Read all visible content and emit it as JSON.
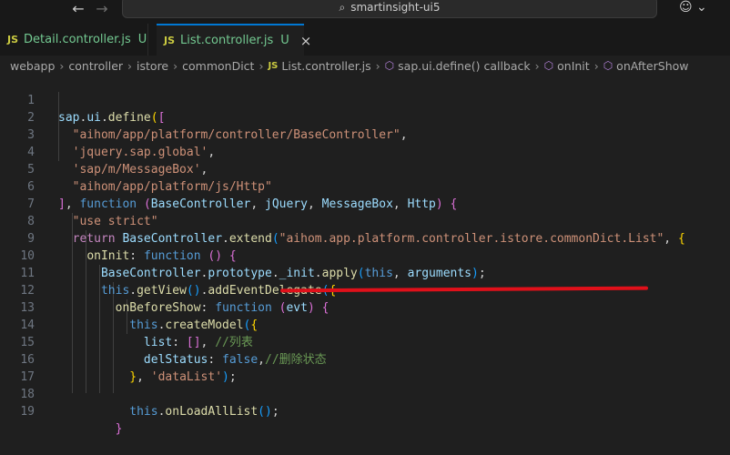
{
  "titlebar": {
    "search_text": "smartinsight-ui5",
    "back_icon": "arrow-left-icon",
    "forward_icon": "arrow-right-icon",
    "search_icon": "search-icon",
    "copilot_icon": "copilot-icon"
  },
  "tabs": [
    {
      "badge": "JS",
      "label": "Detail.controller.js",
      "status": "U",
      "active": false
    },
    {
      "badge": "JS",
      "label": "List.controller.js",
      "status": "U",
      "active": true,
      "close": "×"
    }
  ],
  "breadcrumb": {
    "items": [
      "webapp",
      "controller",
      "istore",
      "commonDict"
    ],
    "file_badge": "JS",
    "file": "List.controller.js",
    "symbols": [
      "sap.ui.define() callback",
      "onInit",
      "onAfterShow"
    ]
  },
  "editor": {
    "line_numbers": [
      "1",
      "2",
      "3",
      "4",
      "5",
      "6",
      "7",
      "8",
      "9",
      "10",
      "11",
      "12",
      "13",
      "14",
      "15",
      "16",
      "17",
      "18",
      "19"
    ],
    "lines": [
      "sap.ui.define([",
      "  \"aihom/app/platform/controller/BaseController\",",
      "  'jquery.sap.global',",
      "  'sap/m/MessageBox',",
      "  \"aihom/app/platform/js/Http\"",
      "], function (BaseController, jQuery, MessageBox, Http) {",
      "  \"use strict\"",
      "  return BaseController.extend(\"aihom.app.platform.controller.istore.commonDict.List\", {",
      "    onInit: function () {",
      "      BaseController.prototype._init.apply(this, arguments);",
      "      this.getView().addEventDelegate({",
      "        onBeforeShow: function (evt) {",
      "          this.createModel({",
      "            list: [], //列表",
      "            delStatus: false,//删除状态",
      "          }, 'dataList');",
      "",
      "          this.onLoadAllList();",
      "        }"
    ]
  },
  "colors": {
    "background": "#1f1f1f",
    "accent": "#0078d4",
    "annotation_underline": "#e0101a",
    "untracked": "#73c991"
  }
}
